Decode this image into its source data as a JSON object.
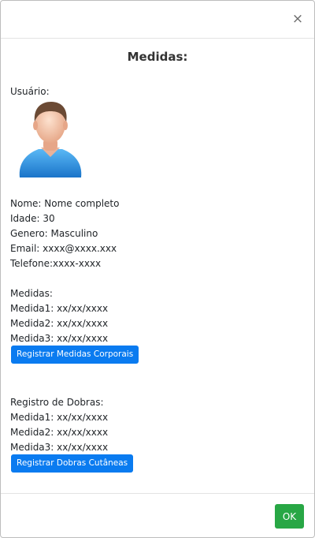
{
  "modal": {
    "close_symbol": "×",
    "title": "Medidas:",
    "ok_label": "OK"
  },
  "user": {
    "heading": "Usuário:",
    "avatar_icon": "user-avatar-icon",
    "name": "Nome: Nome completo",
    "age": "Idade: 30",
    "gender": "Genero: Masculino",
    "email": "Email: xxxx@xxxx.xxx",
    "phone": "Telefone:xxxx-xxxx"
  },
  "measures": {
    "heading": "Medidas:",
    "items": [
      "Medida1: xx/xx/xxxx",
      "Medida2: xx/xx/xxxx",
      "Medida3: xx/xx/xxxx"
    ],
    "button_label": "Registrar Medidas Corporais"
  },
  "folds": {
    "heading": "Registro de Dobras:",
    "items": [
      "Medida1: xx/xx/xxxx",
      "Medida2: xx/xx/xxxx",
      "Medida3: xx/xx/xxxx"
    ],
    "button_label": "Registrar Dobras Cutâneas"
  },
  "colors": {
    "primary": "#0a7bf0",
    "success": "#28a745"
  }
}
